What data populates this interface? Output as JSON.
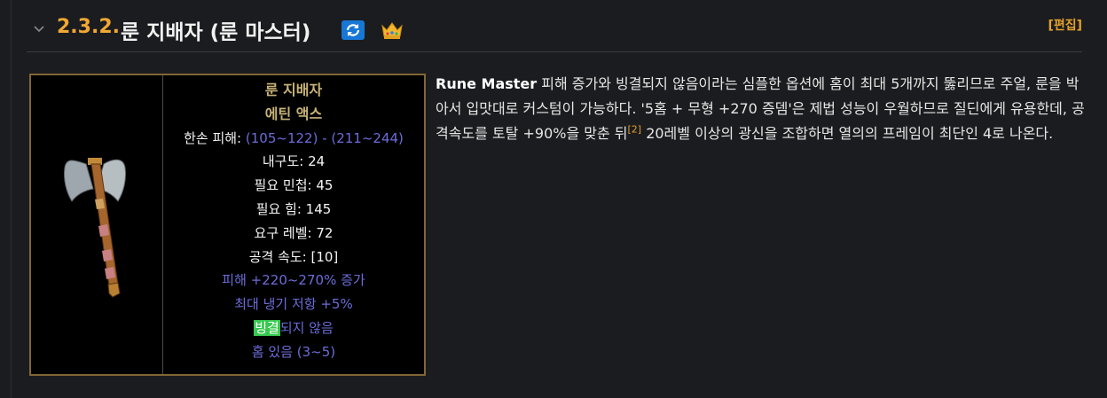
{
  "header": {
    "number": "2.3.2.",
    "title": "룬 지배자 (룬 마스터)",
    "edit_label": "[편집]"
  },
  "item": {
    "name": "룬 지배자",
    "base": "에틴 액스",
    "damage_label": "한손 피해:",
    "damage_value": "(105~122) - (211~244)",
    "durability": "내구도: 24",
    "req_dex": "필요 민첩: 45",
    "req_str": "필요 힘: 145",
    "req_level": "요구 레벨: 72",
    "attack_speed": "공격 속도: [10]",
    "mod_damage": "피해 +220~270% 증가",
    "mod_cold_res": "최대 냉기 저항 +5%",
    "mod_freeze_hl": "빙결",
    "mod_freeze_rest": "되지 않음",
    "mod_sockets": "홈 있음 (3~5)"
  },
  "description": {
    "bold_name": "Rune Master",
    "part1": " 피해 증가와 빙결되지 않음이라는 심플한 옵션에 홈이 최대 5개까지 뚫리므로 주얼, 룬을 박아서 입맛대로 커스텀이 가능하다. '5홈 + 무형 +270 증뎀'은 제법 성능이 우월하므로 질딘에게 유용한데, 공격속도를 토탈 +90%을 맞춘 뒤",
    "footnote": "[2]",
    "part2": " 20레벨 이상의 광신을 조합하면 열의의 프레임이 최단인 4로 나온다."
  },
  "colors": {
    "accent": "#f0a833",
    "card_border": "#826637",
    "stat_blue": "#6c6cd9",
    "item_gold": "#c7b377",
    "highlight_green": "#37c84f"
  },
  "icons": [
    "chevron-down-icon",
    "sync-icon",
    "crown-icon",
    "axe-image"
  ]
}
